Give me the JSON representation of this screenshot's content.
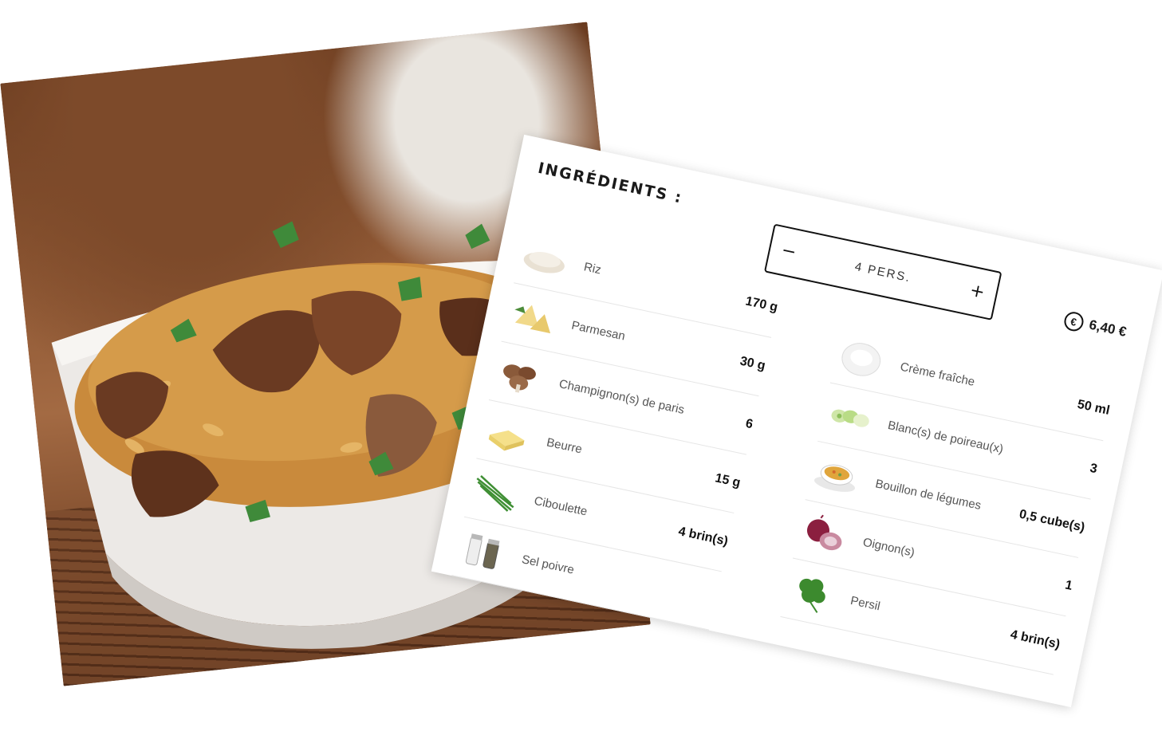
{
  "ingredients": {
    "title": "INGRÉDIENTS :",
    "servings": {
      "minus": "−",
      "label": "4 PERS.",
      "plus": "+"
    },
    "price": {
      "icon": "euro-icon",
      "symbol": "€",
      "value": "6,40 €"
    },
    "left": [
      {
        "name": "Riz",
        "qty": "170 g",
        "icon": "rice-icon"
      },
      {
        "name": "Parmesan",
        "qty": "30 g",
        "icon": "parmesan-icon"
      },
      {
        "name": "Champignon(s) de paris",
        "qty": "6",
        "icon": "mushroom-icon"
      },
      {
        "name": "Beurre",
        "qty": "15 g",
        "icon": "butter-icon"
      },
      {
        "name": "Ciboulette",
        "qty": "4 brin(s)",
        "icon": "chive-icon"
      },
      {
        "name": "Sel poivre",
        "qty": "",
        "icon": "salt-pepper-icon"
      }
    ],
    "right": [
      {
        "name": "Crème fraîche",
        "qty": "50 ml",
        "icon": "cream-icon"
      },
      {
        "name": "Blanc(s) de poireau(x)",
        "qty": "3",
        "icon": "leek-icon"
      },
      {
        "name": "Bouillon de légumes",
        "qty": "0,5 cube(s)",
        "icon": "broth-icon"
      },
      {
        "name": "Oignon(s)",
        "qty": "1",
        "icon": "onion-icon"
      },
      {
        "name": "Persil",
        "qty": "4 brin(s)",
        "icon": "parsley-icon"
      }
    ]
  }
}
